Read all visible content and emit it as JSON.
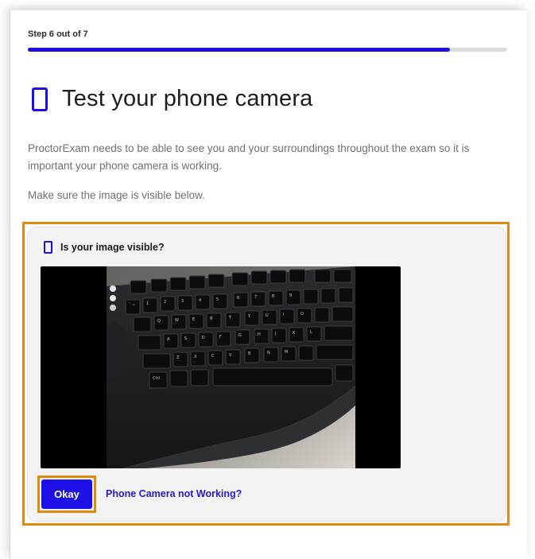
{
  "step": {
    "label": "Step 6 out of 7",
    "progress_fraction": 0.88
  },
  "header": {
    "icon": "phone-icon",
    "title": "Test your phone camera"
  },
  "content": {
    "description": "ProctorExam needs to be able to see you and your surroundings throughout the exam so it is important your phone camera is working.",
    "hint": "Make sure the image is visible below."
  },
  "card": {
    "icon": "phone-icon",
    "question": "Is your image visible?",
    "okay_label": "Okay",
    "not_working_label": "Phone Camera not Working?"
  },
  "colors": {
    "accent": "#1e0fe6",
    "highlight": "#e08a10",
    "link": "#2a18c8"
  }
}
